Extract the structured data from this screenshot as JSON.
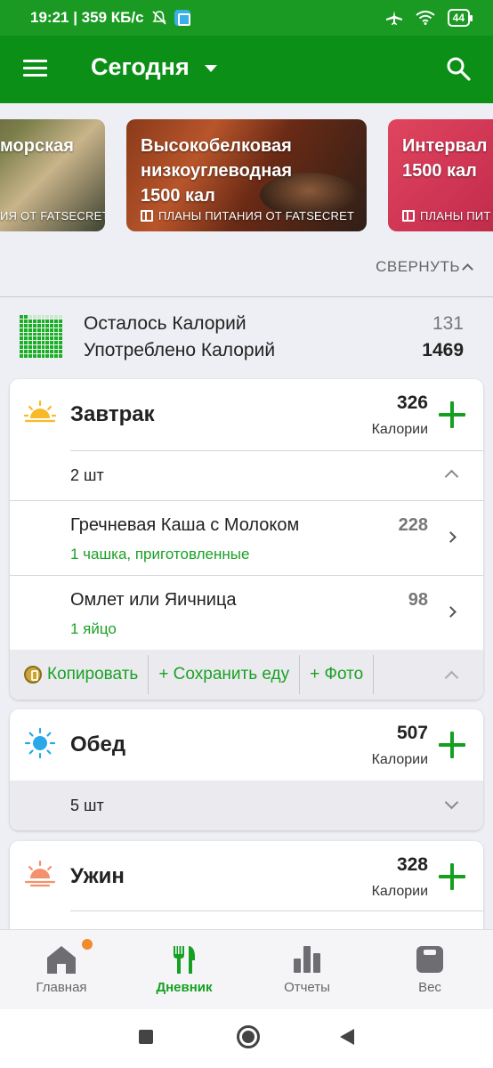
{
  "status_bar": {
    "time_speed": "19:21 | 359 КБ/с",
    "battery": "44"
  },
  "app_bar": {
    "title": "Сегодня"
  },
  "banners": [
    {
      "title_lines": [
        "морская"
      ],
      "subtitle": "ИЯ ОТ FATSECRET"
    },
    {
      "title_lines": [
        "Высокобелковая",
        "низкоуглеводная",
        "1500 кал"
      ],
      "subtitle": "ПЛАНЫ ПИТАНИЯ ОТ FATSECRET"
    },
    {
      "title_lines": [
        "Интервал",
        "1500 кал"
      ],
      "subtitle": "ПЛАНЫ ПИТ"
    }
  ],
  "collapse": {
    "label": "СВЕРНУТЬ"
  },
  "summary": {
    "remaining_label": "Осталось Калорий",
    "remaining_value": "131",
    "consumed_label": "Употреблено Калорий",
    "consumed_value": "1469",
    "consumed_fraction": 0.918
  },
  "breakfast": {
    "title": "Завтрак",
    "calories": "326",
    "calories_label": "Калории",
    "count": "2 шт",
    "items": [
      {
        "name": "Гречневая Каша с Молоком",
        "portion": "1 чашка, приготовленные",
        "kcal": "228"
      },
      {
        "name": "Омлет или Яичница",
        "portion": "1 яйцо",
        "kcal": "98"
      }
    ],
    "actions": {
      "copy": "Копировать",
      "save": "+ Сохранить еду",
      "photo": "+ Фото"
    }
  },
  "lunch": {
    "title": "Обед",
    "calories": "507",
    "calories_label": "Калории",
    "count": "5 шт"
  },
  "dinner": {
    "title": "Ужин",
    "calories": "328",
    "calories_label": "Калории"
  },
  "bottom_nav": [
    {
      "label": "Главная"
    },
    {
      "label": "Дневник"
    },
    {
      "label": "Отчеты"
    },
    {
      "label": "Вес"
    }
  ],
  "colors": {
    "primary_green": "#0c8f16",
    "accent_green": "#1aa126",
    "badge_orange": "#f28a2e"
  }
}
